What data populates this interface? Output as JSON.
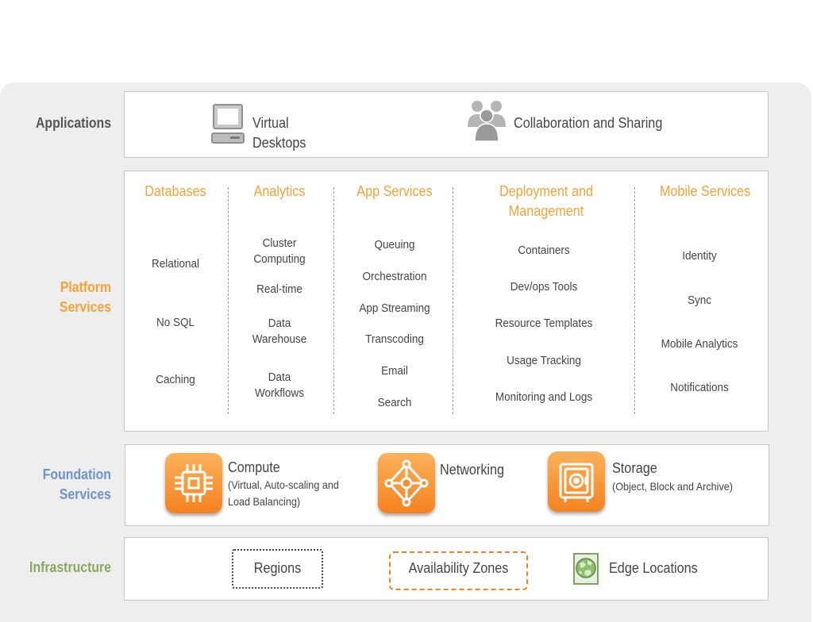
{
  "rows": {
    "applications": "Applications",
    "platform_line1": "Platform",
    "platform_line2": "Services",
    "foundation_line1": "Foundation",
    "foundation_line2": "Services",
    "infrastructure": "Infrastructure"
  },
  "colors": {
    "applications": "#555555",
    "platform": "#f7a234",
    "foundation": "#6e93c9",
    "infrastructure": "#88a860",
    "accent": "#f58220"
  },
  "applications": {
    "virtual_line1": "Virtual",
    "virtual_line2": "Desktops",
    "collab": "Collaboration and Sharing"
  },
  "platform": {
    "columns": [
      {
        "header": "Databases",
        "items": [
          "Relational",
          "No SQL",
          "Caching"
        ]
      },
      {
        "header": "Analytics",
        "items": [
          "Cluster\nComputing",
          "Real-time",
          "Data\nWarehouse",
          "Data\nWorkflows"
        ]
      },
      {
        "header": "App Services",
        "items": [
          "Queuing",
          "Orchestration",
          "App Streaming",
          "Transcoding",
          "Email",
          "Search"
        ]
      },
      {
        "header": "Deployment and\nManagement",
        "items": [
          "Containers",
          "Dev/ops Tools",
          "Resource Templates",
          "Usage Tracking",
          "Monitoring and Logs"
        ]
      },
      {
        "header": "Mobile Services",
        "items": [
          "Identity",
          "Sync",
          "Mobile Analytics",
          "Notifications"
        ]
      }
    ]
  },
  "foundation": {
    "compute_title": "Compute",
    "compute_sub1": "(Virtual, Auto-scaling and",
    "compute_sub2": "Load Balancing)",
    "networking": "Networking",
    "storage_title": "Storage",
    "storage_sub": "(Object, Block and Archive)",
    "icons": [
      "chip-icon",
      "network-icon",
      "vault-icon"
    ]
  },
  "infrastructure": {
    "regions": "Regions",
    "zones": "Availability Zones",
    "edge": "Edge Locations",
    "edge_icon": "globe-icon"
  }
}
